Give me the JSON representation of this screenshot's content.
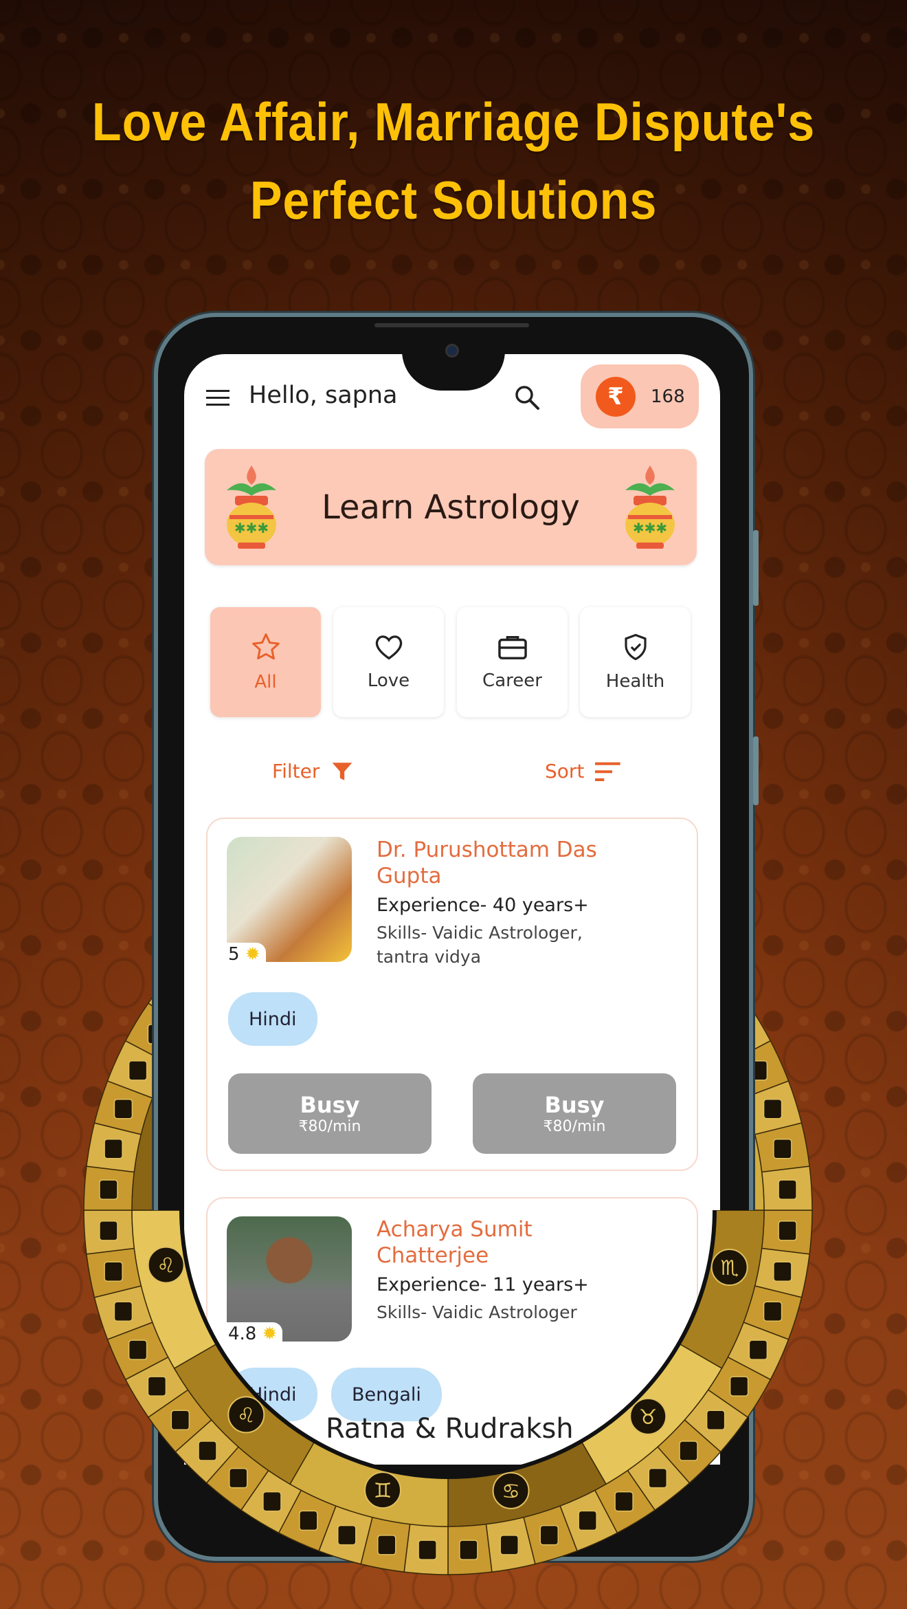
{
  "headline": {
    "line1": "Love Affair, Marriage Dispute's",
    "line2": "Perfect Solutions"
  },
  "colors": {
    "headline": "#FFC107",
    "accent": "#E8602A",
    "wallet_bg": "#FBC6B4",
    "busy": "#9E9E9E",
    "language_chip": "#BEE0F8",
    "ring_gold": "#C9A23A"
  },
  "header": {
    "menu_icon": "hamburger-icon",
    "greeting": "Hello, sapna",
    "search_icon": "search-icon",
    "wallet": {
      "currency_symbol": "₹",
      "balance": "168"
    }
  },
  "banner": {
    "title": "Learn Astrology",
    "icon": "kalash-icon"
  },
  "categories": [
    {
      "label": "All",
      "icon": "star-icon",
      "active": true
    },
    {
      "label": "Love",
      "icon": "heart-icon",
      "active": false
    },
    {
      "label": "Career",
      "icon": "briefcase-icon",
      "active": false
    },
    {
      "label": "Health",
      "icon": "shield-check-icon",
      "active": false
    }
  ],
  "filter_label": "Filter",
  "sort_label": "Sort",
  "astrologers": [
    {
      "name": "Dr. Purushottam Das Gupta",
      "experience": "Experience- 40 years+",
      "skills": "Skills- Vaidic Astrologer, tantra vidya",
      "rating": "5",
      "languages": [
        "Hindi"
      ],
      "actions": [
        {
          "status": "Busy",
          "price": "₹80/min"
        },
        {
          "status": "Busy",
          "price": "₹80/min"
        }
      ]
    },
    {
      "name": "Acharya Sumit Chatterjee",
      "experience": "Experience- 11  years+",
      "skills": "Skills- Vaidic Astrologer",
      "rating": "4.8",
      "languages": [
        "Hindi",
        "Bengali"
      ]
    }
  ],
  "next_section": "Ratna & Rudraksh",
  "zodiac_signs": [
    "♌",
    "♌",
    "♊",
    "♋",
    "♉",
    "♏"
  ]
}
